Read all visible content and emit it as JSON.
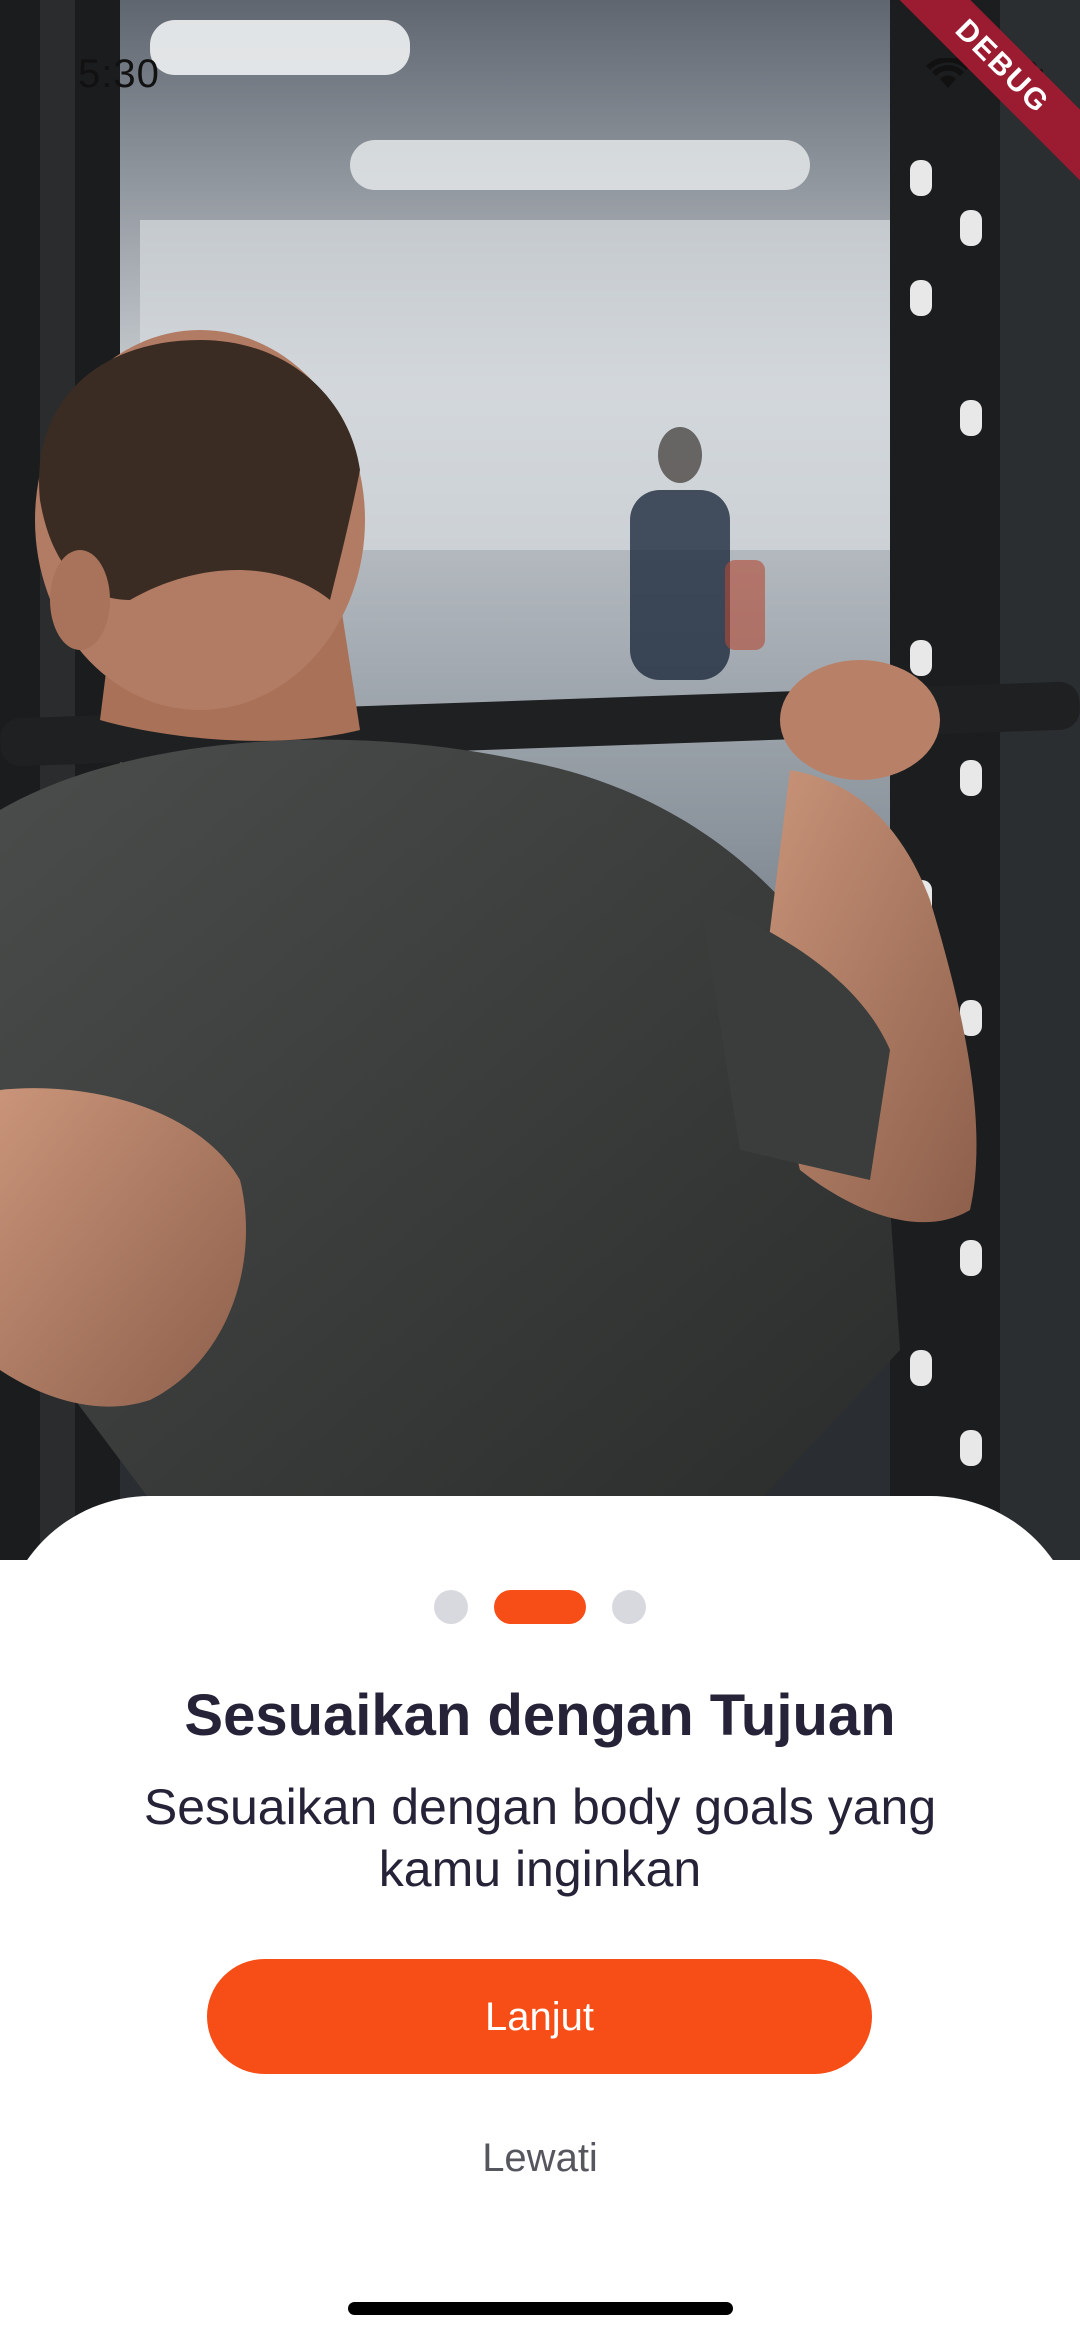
{
  "status_bar": {
    "time": "5:30",
    "icons": [
      "wifi-icon",
      "battery-icon"
    ],
    "debug_banner": "DEBUG"
  },
  "hero": {
    "image": "gym-squat-photo"
  },
  "onboarding": {
    "page_indicator": {
      "total": 3,
      "active_index": 1
    },
    "title": "Sesuaikan dengan Tujuan",
    "subtitle": "Sesuaikan dengan body goals yang kamu inginkan",
    "primary_button_label": "Lanjut",
    "skip_button_label": "Lewati"
  },
  "colors": {
    "accent": "#F74D16",
    "text_dark": "#262338",
    "dot_inactive": "#D8D9DE",
    "skip_text": "#56565F"
  }
}
